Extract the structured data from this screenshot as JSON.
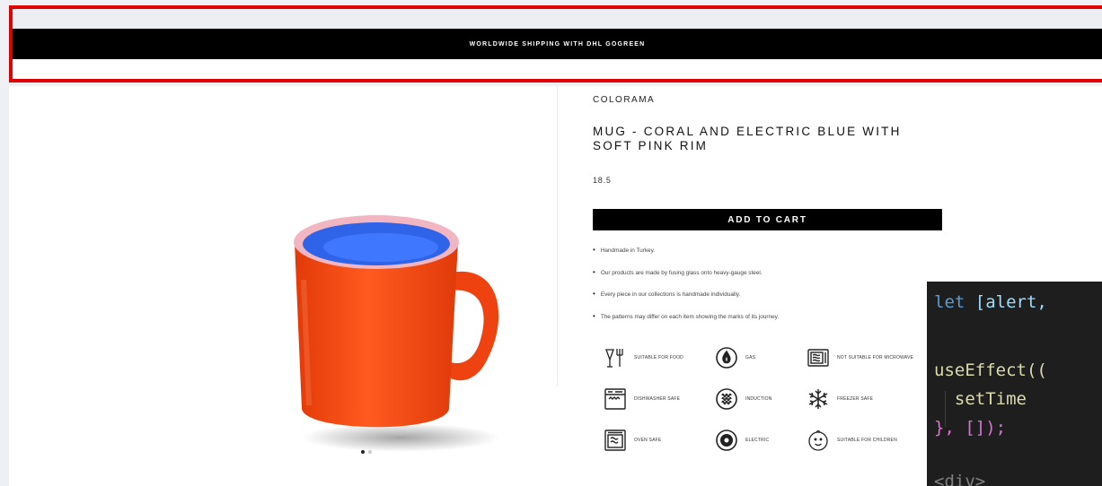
{
  "announcement": {
    "text": "WORLDWIDE SHIPPING WITH DHL GOGREEN"
  },
  "product": {
    "brand": "COLORAMA",
    "title": "MUG - CORAL AND ELECTRIC BLUE WITH SOFT PINK RIM",
    "price": "18.5",
    "add_to_cart_label": "ADD TO CART",
    "features": [
      "Handmade in Turkey.",
      "Our products are made by fusing glass onto heavy-gauge steel.",
      "Every piece in our collections is handmade individually.",
      "The patterns may differ on each item showing the marks of its journey."
    ],
    "care_icons": [
      {
        "icon": "fork-glass-icon",
        "label": "SUITABLE FOR FOOD"
      },
      {
        "icon": "gas-flame-icon",
        "label": "GAS"
      },
      {
        "icon": "microwave-icon",
        "label": "NOT SUITABLE FOR MICROWAVE"
      },
      {
        "icon": "dishwasher-icon",
        "label": "DISHWASHER SAFE"
      },
      {
        "icon": "induction-coil-icon",
        "label": "INDUCTION"
      },
      {
        "icon": "snowflake-icon",
        "label": "FREEZER SAFE"
      },
      {
        "icon": "oven-icon",
        "label": "OVEN SAFE"
      },
      {
        "icon": "electric-hob-icon",
        "label": "ELECTRIC"
      },
      {
        "icon": "child-face-icon",
        "label": "SUITABLE FOR CHILDREN"
      }
    ]
  },
  "gallery": {
    "slide_count": 2,
    "active_slide": 1
  },
  "colors": {
    "highlight_border": "#e10000",
    "mug_body": "#ff4a14",
    "mug_inner": "#2f63e8",
    "mug_rim": "#f2b6c2",
    "announcement_bg": "#000000"
  },
  "code_overlay": {
    "lines": [
      {
        "kw": "let ",
        "rest": "[alert,"
      },
      {
        "kw": "",
        "rest": "useEffect(("
      },
      {
        "kw": "",
        "rest": "  setTime"
      },
      {
        "kw": "",
        "rest": "}, []);"
      },
      {
        "kw": "",
        "rest": "<div>"
      }
    ]
  }
}
